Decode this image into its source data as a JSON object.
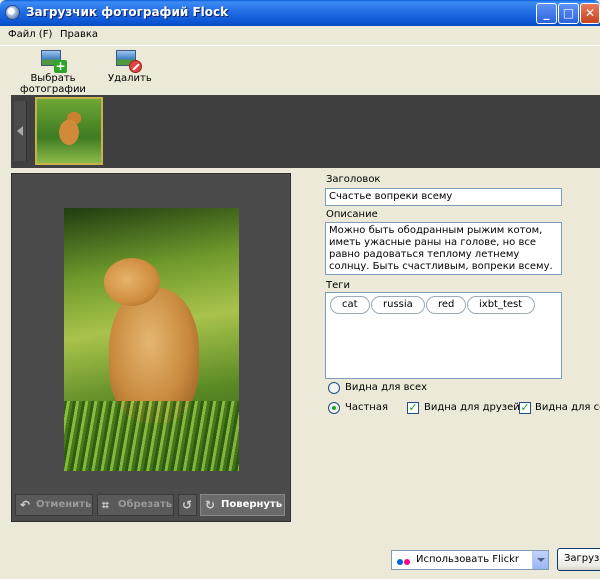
{
  "window": {
    "title": "Загрузчик фотографий Flock"
  },
  "menu": {
    "file": "Файл (F)",
    "edit": "Правка"
  },
  "toolbar": {
    "add_label": "Выбрать фотографии",
    "delete_label": "Удалить"
  },
  "preview": {
    "undo_label": "Отменить",
    "crop_label": "Обрезать",
    "rotate_label": "Повернуть"
  },
  "form": {
    "title_label": "Заголовок",
    "title_value": "Счастье вопреки всему",
    "desc_label": "Описание",
    "desc_value": "Можно быть ободранным рыжим котом, иметь ужасные раны на голове, но все равно радоваться теплому летнему солнцу. Быть счастливым, вопреки всему.",
    "tags_label": "Теги",
    "tags": [
      "cat",
      "russia",
      "red",
      "ixbt_test"
    ],
    "privacy": {
      "public_label": "Видна для всех",
      "private_label": "Частная",
      "selected": "private",
      "friends_label": "Видна для друзей",
      "friends_checked": true,
      "family_label": "Видна для семьи",
      "family_checked": true
    }
  },
  "footer": {
    "service_value": "Использовать Flickr",
    "upload_label": "Загрузить"
  },
  "colors": {
    "flickr_blue": "#0063dc",
    "flickr_pink": "#ff0084",
    "check_green": "#21a121"
  }
}
